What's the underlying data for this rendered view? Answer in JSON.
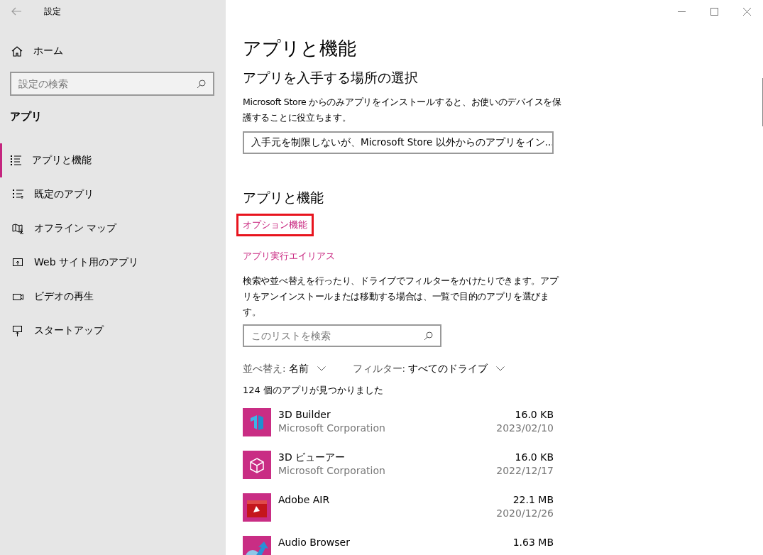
{
  "window": {
    "title": "設定"
  },
  "sidebar": {
    "home": "ホーム",
    "search": {
      "placeholder": "設定の検索"
    },
    "section": "アプリ",
    "items": [
      {
        "label": "アプリと機能",
        "selected": true
      },
      {
        "label": "既定のアプリ",
        "selected": false
      },
      {
        "label": "オフライン マップ",
        "selected": false
      },
      {
        "label": "Web サイト用のアプリ",
        "selected": false
      },
      {
        "label": "ビデオの再生",
        "selected": false
      },
      {
        "label": "スタートアップ",
        "selected": false
      }
    ]
  },
  "main": {
    "title": "アプリと機能",
    "source": {
      "heading": "アプリを入手する場所の選択",
      "description": "Microsoft Store からのみアプリをインストールすると、お使いのデバイスを保護することに役立ちます。",
      "dropdown": "入手元を制限しないが、Microsoft Store 以外からのアプリをイン..."
    },
    "apps": {
      "heading": "アプリと機能",
      "links": [
        {
          "label": "オプション機能",
          "highlighted": true
        },
        {
          "label": "アプリ実行エイリアス",
          "highlighted": false
        }
      ],
      "description": "検索や並べ替えを行ったり、ドライブでフィルターをかけたりできます。アプリをアンインストールまたは移動する場合は、一覧で目的のアプリを選びます。",
      "search": {
        "placeholder": "このリストを検索"
      },
      "sort": {
        "label": "並べ替え:",
        "value": "名前"
      },
      "filter": {
        "label": "フィルター:",
        "value": "すべてのドライブ"
      },
      "count": "124 個のアプリが見つかりました",
      "list": [
        {
          "name": "3D Builder",
          "publisher": "Microsoft Corporation",
          "size": "16.0 KB",
          "date": "2023/02/10"
        },
        {
          "name": "3D ビューアー",
          "publisher": "Microsoft Corporation",
          "size": "16.0 KB",
          "date": "2022/12/17"
        },
        {
          "name": "Adobe AIR",
          "size": "22.1 MB",
          "date": "2020/12/26"
        },
        {
          "name": "Audio Browser",
          "size": "1.63 MB"
        }
      ]
    }
  }
}
